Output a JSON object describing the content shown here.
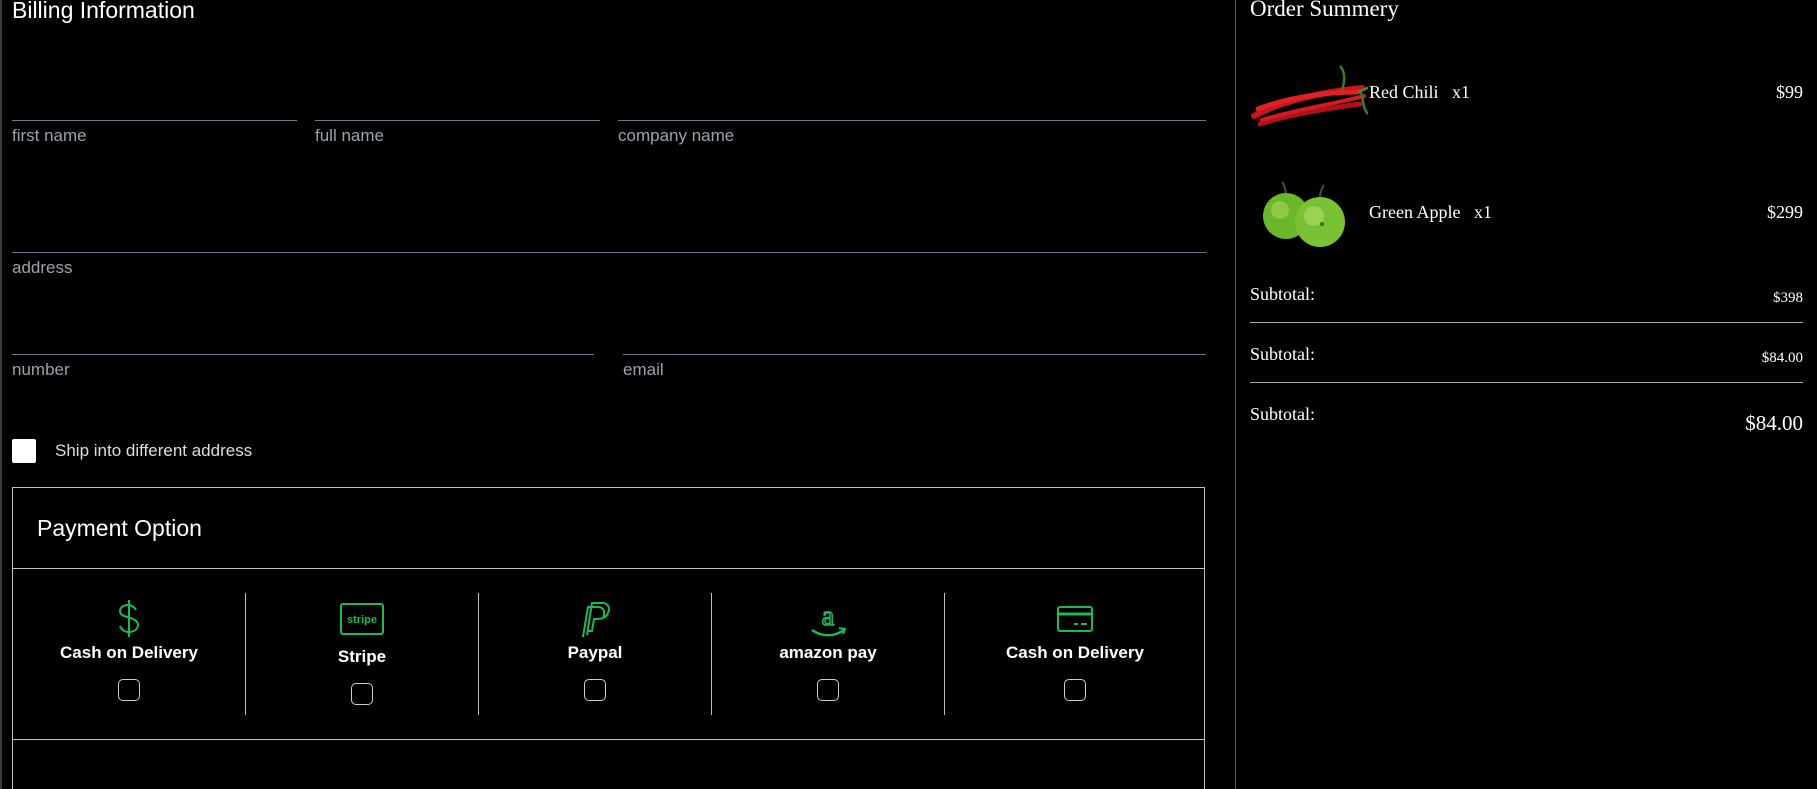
{
  "billing": {
    "title": "Billing Information",
    "fields": {
      "first_name": "first name",
      "full_name": "full name",
      "company_name": "company name",
      "address": "address",
      "number": "number",
      "email": "email"
    },
    "ship_label": "Ship into different address"
  },
  "payment": {
    "title": "Payment Option",
    "options": [
      {
        "label": "Cash on Delivery",
        "icon": "dollar-icon"
      },
      {
        "label": "Stripe",
        "icon": "stripe-icon"
      },
      {
        "label": "Paypal",
        "icon": "paypal-icon"
      },
      {
        "label": "amazon pay",
        "icon": "amazon-icon"
      },
      {
        "label": "Cash on Delivery",
        "icon": "credit-card-icon"
      }
    ],
    "accent_color": "#1db954"
  },
  "summary": {
    "title": "Order Summery",
    "items": [
      {
        "name": "Red Chili",
        "qty": "x1",
        "price": "$99",
        "image": "red-chili-image"
      },
      {
        "name": "Green Apple",
        "qty": "x1",
        "price": "$299",
        "image": "green-apple-image"
      }
    ],
    "rows": [
      {
        "label": "Subtotal:",
        "value": "$398"
      },
      {
        "label": "Subtotal:",
        "value": "$84.00"
      },
      {
        "label": "Subtotal:",
        "value": "$84.00"
      }
    ]
  }
}
